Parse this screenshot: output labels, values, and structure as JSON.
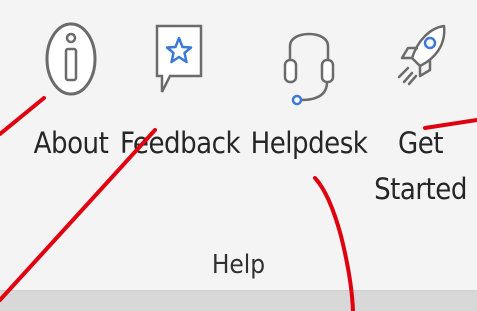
{
  "ribbon": {
    "group_label": "Help",
    "commands": [
      {
        "id": "about",
        "label": "About",
        "icon": "info-icon"
      },
      {
        "id": "feedback",
        "label": "Feedback",
        "icon": "feedback-icon"
      },
      {
        "id": "helpdesk",
        "label": "Helpdesk",
        "icon": "headset-icon"
      },
      {
        "id": "getstarted",
        "label_line1": "Get",
        "label_line2": "Started",
        "icon": "rocket-icon"
      }
    ]
  },
  "colors": {
    "icon_stroke": "#6b6b6b",
    "icon_accent": "#3b78d8",
    "annotation": "#e0000f",
    "text": "#262626"
  }
}
